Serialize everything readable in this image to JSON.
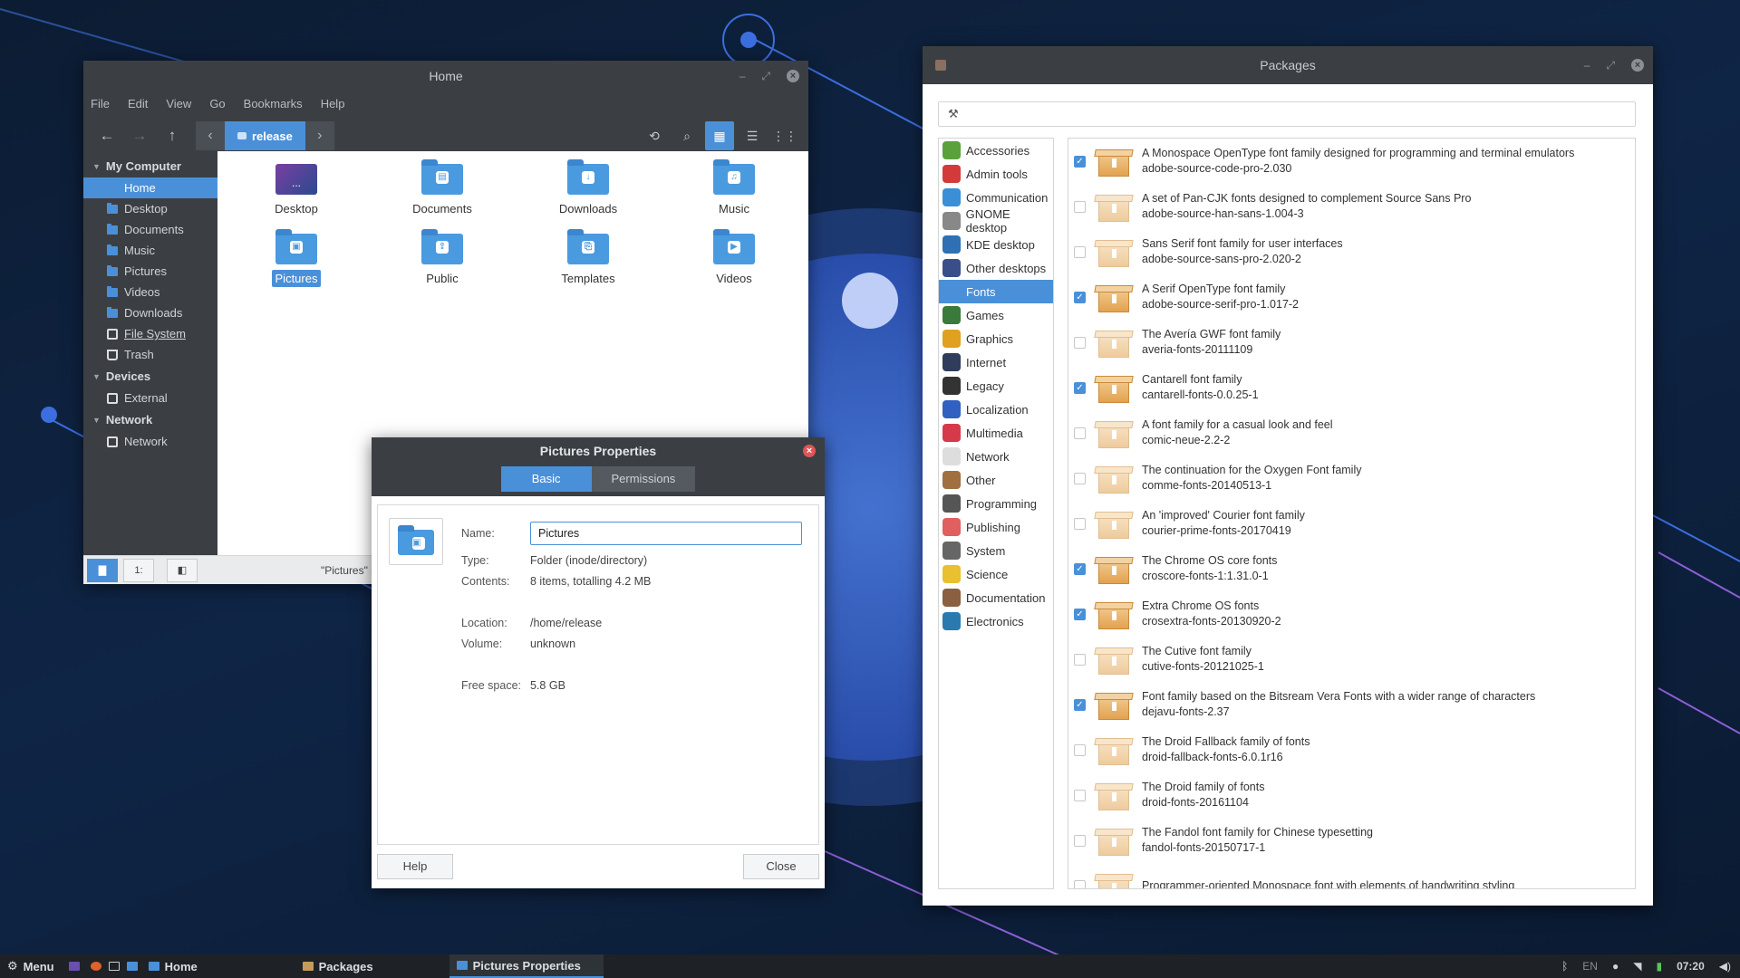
{
  "colors": {
    "accent": "#4a90d9",
    "titlebar": "#3b3f44",
    "taskbar": "#1e2226"
  },
  "home": {
    "title": "Home",
    "menu": [
      "File",
      "Edit",
      "View",
      "Go",
      "Bookmarks",
      "Help"
    ],
    "crumb": "release",
    "sidebar": {
      "sections": [
        {
          "label": "My Computer",
          "items": [
            {
              "label": "Home",
              "icon": "folder-icon"
            },
            {
              "label": "Desktop",
              "icon": "folder-icon"
            },
            {
              "label": "Documents",
              "icon": "folder-icon"
            },
            {
              "label": "Music",
              "icon": "folder-icon"
            },
            {
              "label": "Pictures",
              "icon": "folder-icon"
            },
            {
              "label": "Videos",
              "icon": "folder-icon"
            },
            {
              "label": "Downloads",
              "icon": "folder-icon"
            },
            {
              "label": "File System",
              "icon": "drive-icon"
            },
            {
              "label": "Trash",
              "icon": "trash-icon"
            }
          ]
        },
        {
          "label": "Devices",
          "items": [
            {
              "label": "External",
              "icon": "drive-icon"
            }
          ]
        },
        {
          "label": "Network",
          "items": [
            {
              "label": "Network",
              "icon": "network-icon"
            }
          ]
        }
      ]
    },
    "files": [
      {
        "label": "Desktop",
        "glyph": "..."
      },
      {
        "label": "Documents",
        "glyph": "▤"
      },
      {
        "label": "Downloads",
        "glyph": "↓"
      },
      {
        "label": "Music",
        "glyph": "♫"
      },
      {
        "label": "Pictures",
        "glyph": "▣"
      },
      {
        "label": "Public",
        "glyph": "⇪"
      },
      {
        "label": "Templates",
        "glyph": "⎘"
      },
      {
        "label": "Videos",
        "glyph": "▶"
      }
    ],
    "status": "\"Pictures\" se",
    "status_btn": "1:"
  },
  "props": {
    "title": "Pictures Properties",
    "tabs": [
      "Basic",
      "Permissions"
    ],
    "name_label": "Name:",
    "name_value": "Pictures",
    "type_label": "Type:",
    "type_value": "Folder (inode/directory)",
    "contents_label": "Contents:",
    "contents_value": "8 items, totalling 4.2 MB",
    "location_label": "Location:",
    "location_value": "/home/release",
    "volume_label": "Volume:",
    "volume_value": "unknown",
    "free_label": "Free space:",
    "free_value": "5.8 GB",
    "help": "Help",
    "close": "Close"
  },
  "pkgs": {
    "title": "Packages",
    "search_placeholder": "",
    "categories": [
      {
        "label": "Accessories",
        "color": "#5aa13c"
      },
      {
        "label": "Admin tools",
        "color": "#d33b3b"
      },
      {
        "label": "Communication",
        "color": "#3a8fd6"
      },
      {
        "label": "GNOME desktop",
        "color": "#888888"
      },
      {
        "label": "KDE desktop",
        "color": "#2f6fb3"
      },
      {
        "label": "Other desktops",
        "color": "#3a4f8a"
      },
      {
        "label": "Fonts",
        "color": "#4a90d9"
      },
      {
        "label": "Games",
        "color": "#3a7a3a"
      },
      {
        "label": "Graphics",
        "color": "#e0a020"
      },
      {
        "label": "Internet",
        "color": "#2f3c5a"
      },
      {
        "label": "Legacy",
        "color": "#333333"
      },
      {
        "label": "Localization",
        "color": "#3060c0"
      },
      {
        "label": "Multimedia",
        "color": "#d63a4a"
      },
      {
        "label": "Network",
        "color": "#dddddd"
      },
      {
        "label": "Other",
        "color": "#a07040"
      },
      {
        "label": "Programming",
        "color": "#555555"
      },
      {
        "label": "Publishing",
        "color": "#e06060"
      },
      {
        "label": "System",
        "color": "#666666"
      },
      {
        "label": "Science",
        "color": "#e8c030"
      },
      {
        "label": "Documentation",
        "color": "#8a6040"
      },
      {
        "label": "Electronics",
        "color": "#2a7ab0"
      }
    ],
    "selected_category": "Fonts",
    "packages": [
      {
        "desc": "A Monospace OpenType font family designed for programming and terminal emulators",
        "name": "adobe-source-code-pro-2.030",
        "checked": true
      },
      {
        "desc": "A set of Pan-CJK fonts designed to complement Source Sans Pro",
        "name": "adobe-source-han-sans-1.004-3",
        "checked": false
      },
      {
        "desc": "Sans Serif font family for user interfaces",
        "name": "adobe-source-sans-pro-2.020-2",
        "checked": false
      },
      {
        "desc": "A Serif OpenType font family",
        "name": "adobe-source-serif-pro-1.017-2",
        "checked": true
      },
      {
        "desc": "The Avería GWF font family",
        "name": "averia-fonts-20111109",
        "checked": false
      },
      {
        "desc": "Cantarell font family",
        "name": "cantarell-fonts-0.0.25-1",
        "checked": true
      },
      {
        "desc": "A font family for a casual look and feel",
        "name": "comic-neue-2.2-2",
        "checked": false
      },
      {
        "desc": "The continuation for the Oxygen Font family",
        "name": "comme-fonts-20140513-1",
        "checked": false
      },
      {
        "desc": "An 'improved' Courier font family",
        "name": "courier-prime-fonts-20170419",
        "checked": false
      },
      {
        "desc": "The Chrome OS core fonts",
        "name": "croscore-fonts-1:1.31.0-1",
        "checked": true
      },
      {
        "desc": "Extra Chrome OS fonts",
        "name": "crosextra-fonts-20130920-2",
        "checked": true
      },
      {
        "desc": "The Cutive font family",
        "name": "cutive-fonts-20121025-1",
        "checked": false
      },
      {
        "desc": "Font family based on the Bitsream Vera Fonts with a wider range of characters",
        "name": "dejavu-fonts-2.37",
        "checked": true
      },
      {
        "desc": "The Droid Fallback family of fonts",
        "name": "droid-fallback-fonts-6.0.1r16",
        "checked": false
      },
      {
        "desc": "The Droid family of fonts",
        "name": "droid-fonts-20161104",
        "checked": false
      },
      {
        "desc": "The Fandol font family for Chinese typesetting",
        "name": "fandol-fonts-20150717-1",
        "checked": false
      },
      {
        "desc": "Programmer-oriented Monospace font with elements of handwriting styling",
        "name": "",
        "checked": false
      }
    ]
  },
  "taskbar": {
    "menu": "Menu",
    "windows": [
      {
        "label": "Home",
        "selected": false
      },
      {
        "label": "Packages",
        "selected": false
      },
      {
        "label": "Pictures Properties",
        "selected": true
      }
    ],
    "lang": "EN",
    "time": "07:20"
  }
}
